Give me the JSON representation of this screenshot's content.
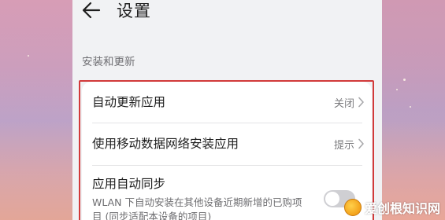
{
  "header": {
    "title": "设置"
  },
  "section": {
    "label": "安装和更新"
  },
  "rows": [
    {
      "label": "自动更新应用",
      "value": "关闭"
    },
    {
      "label": "使用移动数据网络安装应用",
      "value": "提示"
    }
  ],
  "sync": {
    "label": "应用自动同步",
    "description": "WLAN 下自动安装在其他设备近期新增的已购项目 (同步适配本设备的项目)",
    "enabled": false
  },
  "watermark": {
    "text": "爱创根知识网"
  },
  "colors": {
    "highlight": "#d23a3a",
    "page_bg": "#f1f2f4",
    "card_bg": "#ffffff"
  }
}
